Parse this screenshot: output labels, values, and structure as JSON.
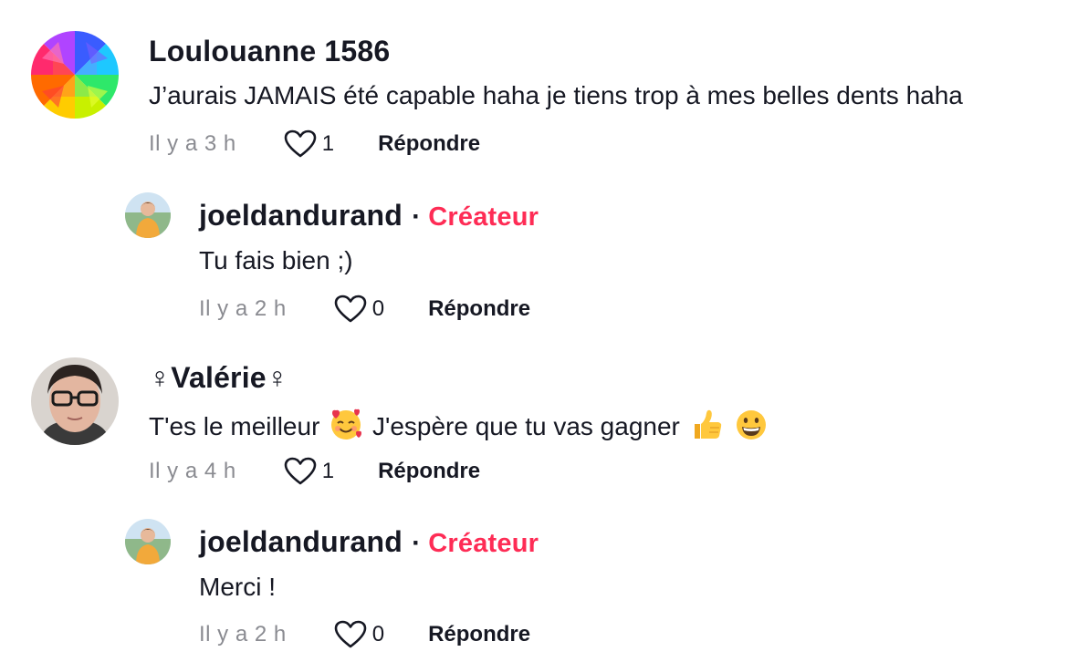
{
  "comments": [
    {
      "username": "Loulouanne 1586",
      "text": "J’aurais JAMAIS été capable haha je tiens trop à mes belles dents haha",
      "time": "Il y a 3 h",
      "likes": "1",
      "reply_label": "Répondre"
    },
    {
      "username": "joeldandurand",
      "badge": "Créateur",
      "text": "Tu fais bien ;)",
      "time": "Il y a 2 h",
      "likes": "0",
      "reply_label": "Répondre"
    },
    {
      "username": "♀Valérie♀",
      "text_part1": "T'es le meilleur",
      "text_part2": "J'espère que tu vas gagner",
      "time": "Il y a 4 h",
      "likes": "1",
      "reply_label": "Répondre"
    },
    {
      "username": "joeldandurand",
      "badge": "Créateur",
      "text": "Merci !",
      "time": "Il y a 2 h",
      "likes": "0",
      "reply_label": "Répondre"
    }
  ],
  "separator": "·",
  "colors": {
    "creator_badge": "#fe2c55",
    "meta_gray": "#8a8b91",
    "text": "#161823"
  },
  "icons": {
    "like": "heart-outline-icon",
    "emoji_1": "smiling-face-with-hearts-emoji",
    "emoji_2": "thumbs-up-emoji",
    "emoji_3": "grinning-face-emoji"
  }
}
